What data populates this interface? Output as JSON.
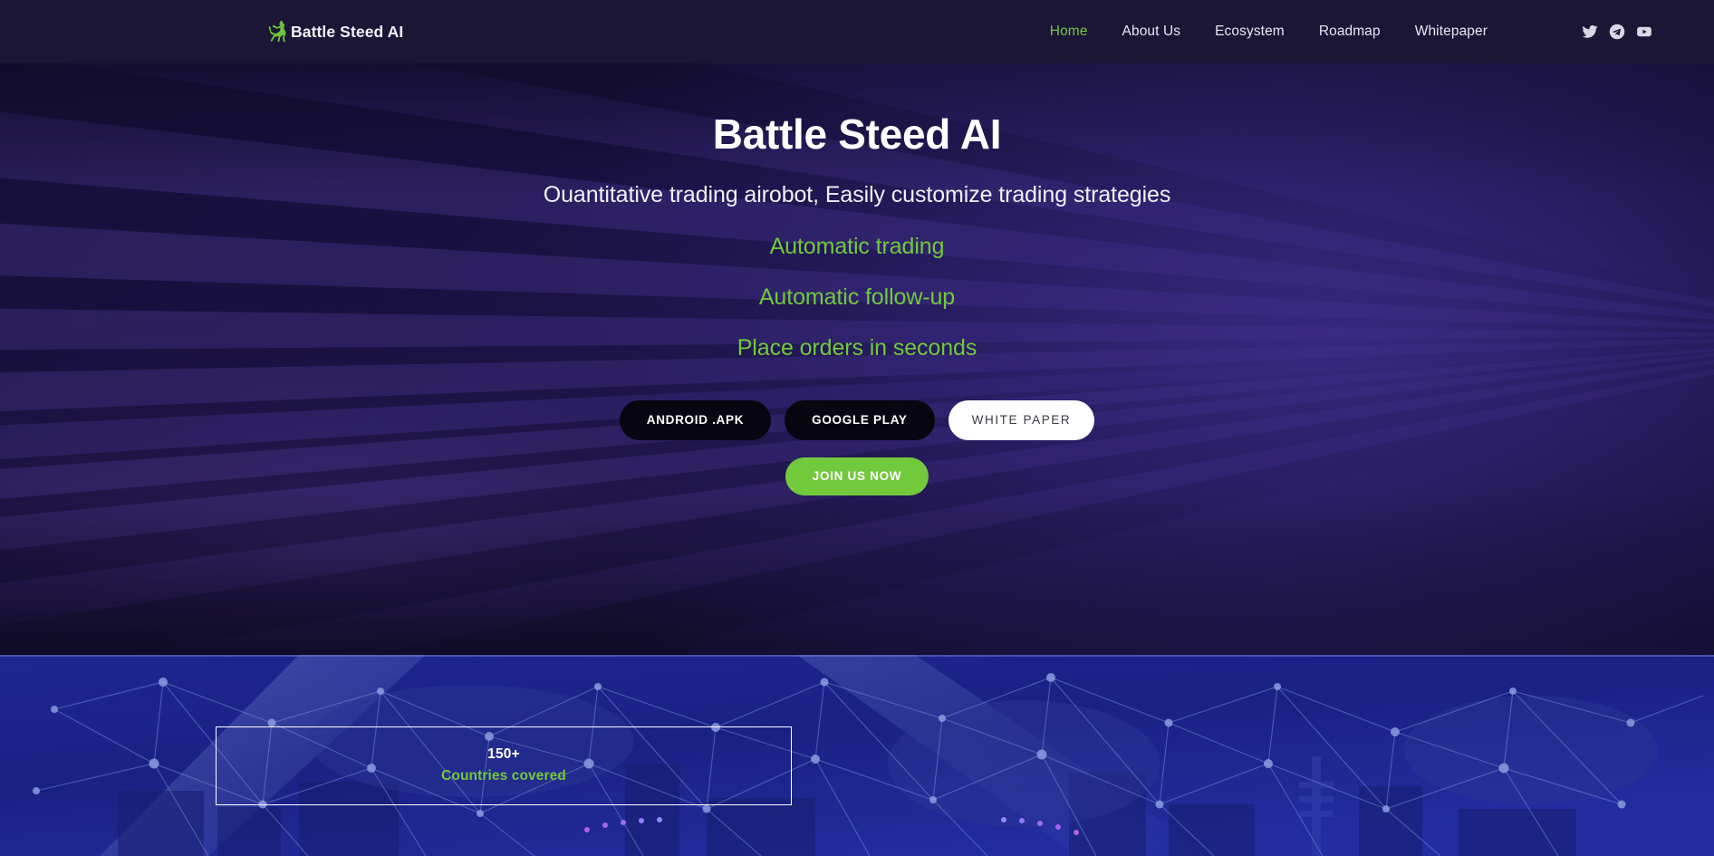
{
  "header": {
    "brand": {
      "name": "Battle Steed AI",
      "icon": "horse-icon"
    },
    "nav": [
      {
        "label": "Home",
        "active": true
      },
      {
        "label": "About Us",
        "active": false
      },
      {
        "label": "Ecosystem",
        "active": false
      },
      {
        "label": "Roadmap",
        "active": false
      },
      {
        "label": "Whitepaper",
        "active": false
      }
    ],
    "social": [
      {
        "name": "twitter-icon"
      },
      {
        "name": "telegram-icon"
      },
      {
        "name": "youtube-icon"
      }
    ]
  },
  "hero": {
    "title": "Battle Steed AI",
    "subtitle": "Ouantitative trading airobot, Easily customize trading strategies",
    "features": [
      "Automatic trading",
      "Automatic follow-up",
      "Place orders in seconds"
    ],
    "buttons": {
      "android": "ANDROID .APK",
      "google_play": "GOOGLE PLAY",
      "white_paper": "WHITE PAPER",
      "join": "JOIN US NOW"
    }
  },
  "stats": {
    "card": {
      "value": "150+",
      "label": "Countries covered"
    }
  },
  "colors": {
    "accent_green": "#72c93c",
    "header_bg": "#1b1536",
    "hero_bg": "#191140",
    "network_bg": "#1b2490",
    "button_dark": "#070510",
    "button_white": "#ffffff"
  }
}
